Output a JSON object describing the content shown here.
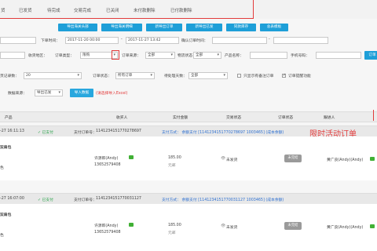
{
  "tabs": [
    "已发货",
    "待完成",
    "交易完成",
    "已关闭",
    "未付款删除",
    "已付款删除"
  ],
  "tab_first": "货",
  "export_buttons": [
    "导出海关头部",
    "导出海关明细",
    "新导出订单",
    "新导出已发",
    "同款库存",
    "总表模板"
  ],
  "filters": {
    "date_start": "2017-11-20 00:00",
    "order_time_label": "下单时间：",
    "date_end": "2017-11-27 13:42",
    "confirm_time_label": "确认订单时间：",
    "dash": "-",
    "check_label": "收货地区：",
    "check_value": "",
    "order_type_label": "订单类型：",
    "order_type_value": "限购",
    "order_source_label": "订单来源：",
    "order_source_value": "全部",
    "logistics_label": "物流状态：",
    "logistics_value": "全部",
    "product_label": "产品名称：",
    "phone_label": "手机号码：",
    "search_btn": "订单",
    "page_size_label": "页记录数：",
    "page_size_value": "20",
    "order_status_label": "订单状态：",
    "order_status_value": "所有订单",
    "pending_label": "待处理天数：",
    "pending_value": "全部",
    "only_remark_label": "只显示有备注订单",
    "only_remind_label": "订单提醒功能",
    "data_source_label": "数据来源：",
    "data_source_value": "导出已发",
    "import_btn": "导入数据",
    "import_note": "(请选择导入Excel)"
  },
  "table_headers": [
    "产品",
    "收买人",
    "实付金额",
    "交易状态",
    "订单状态",
    "跟进人"
  ],
  "promo_label": "限时活动订单",
  "orders": [
    {
      "time": "-27 16:11:13",
      "paid": "已支付",
      "pay_no_label": "支付订单号：",
      "pay_no": "1141234151770278697",
      "pay_method": "支付方式：  余额支付 [1141234151770278697 1003465] (成本余额)",
      "product": "双肩包",
      "product_sub": "色",
      "buyer": "许源郎(Andy)",
      "phone": "13652579408",
      "amount": "185.00",
      "amount_sub": "元邮",
      "trade_status": "未发货",
      "order_btn": "未完结",
      "follower": "黄广良(Andy)(Andy)"
    },
    {
      "time": "-27 16:07:00",
      "paid": "已支付",
      "pay_no_label": "支付订单号：",
      "pay_no": "1141234151770031127",
      "pay_method": "支付方式：  余额支付 [1141234151770031127 1003465] (成本余额)",
      "product": "双肩包",
      "product_sub": "色",
      "buyer": "许源郎(Andy)",
      "phone": "13652579408",
      "amount": "185.00",
      "amount_sub": "元邮",
      "trade_status": "未发货",
      "order_btn": "未完结",
      "follower": "黄广良(Andy)(Andy)"
    }
  ],
  "colors": {
    "accent": "#1e9fd8",
    "promo_red": "#e23b3b",
    "paid_green": "#2aa24a"
  }
}
